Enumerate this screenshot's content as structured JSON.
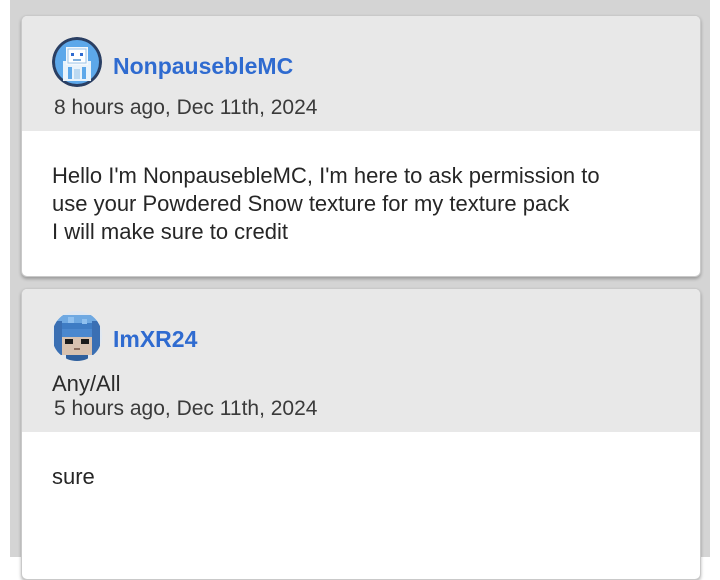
{
  "comments": [
    {
      "username": "NonpausebleMC",
      "timestamp": "8 hours ago, Dec 11th, 2024",
      "body_lines": [
        "Hello I'm NonpausebleMC, I'm here to ask permission to",
        "use your Powdered Snow texture for my texture pack",
        "I will make sure to credit"
      ],
      "avatar_icon": "blue-robot-avatar-icon"
    },
    {
      "username": "ImXR24",
      "role": "Any/All",
      "timestamp": "5 hours ago, Dec 11th, 2024",
      "body_lines": [
        "sure"
      ],
      "avatar_icon": "blue-hair-character-avatar-icon"
    }
  ],
  "colors": {
    "username": "#2f6bd0",
    "header_bg": "#e8e8e8",
    "page_bg": "#d4d4d4",
    "card_bg": "#ffffff"
  }
}
